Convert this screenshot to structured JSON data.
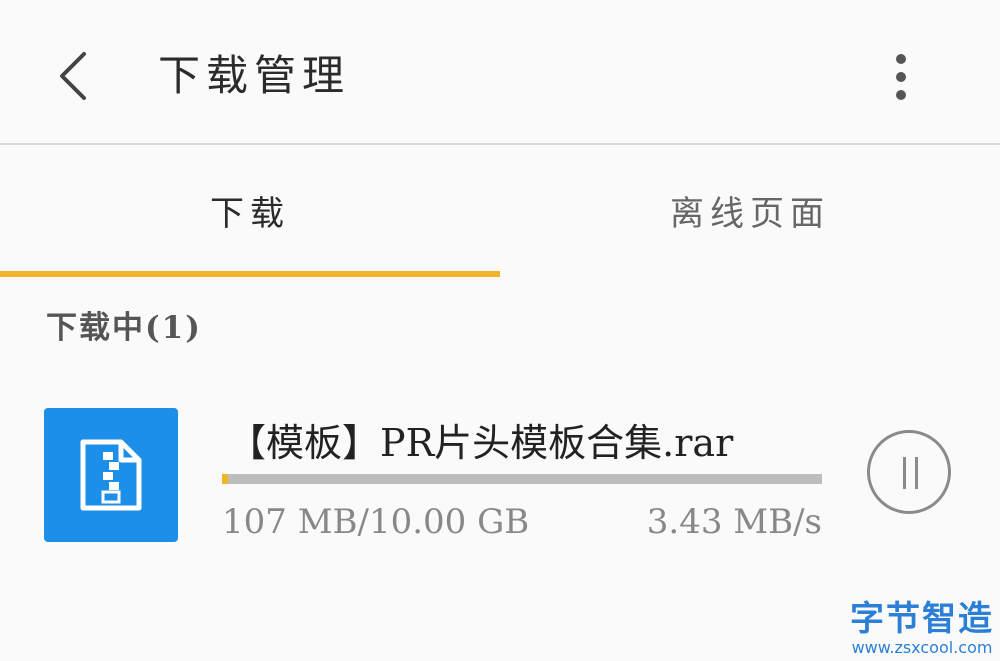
{
  "header": {
    "back_icon": "chevron-left-icon",
    "title": "下载管理",
    "more_icon": "more-vertical-icon"
  },
  "tabs": [
    {
      "label": "下载",
      "active": true
    },
    {
      "label": "离线页面",
      "active": false
    }
  ],
  "colors": {
    "accent": "#f0b429",
    "file_icon_bg": "#1e8fe8",
    "watermark": "#2b7fd6"
  },
  "section": {
    "title": "下载中(1)"
  },
  "download": {
    "icon": "zip-file-icon",
    "name": "【模板】PR片头模板合集.rar",
    "size": "107 MB/10.00 GB",
    "speed": "3.43 MB/s",
    "progress": 0.0105,
    "pause_icon": "pause-icon"
  },
  "watermark": {
    "title": "字节智造",
    "url": "www.zsxcool.com"
  }
}
